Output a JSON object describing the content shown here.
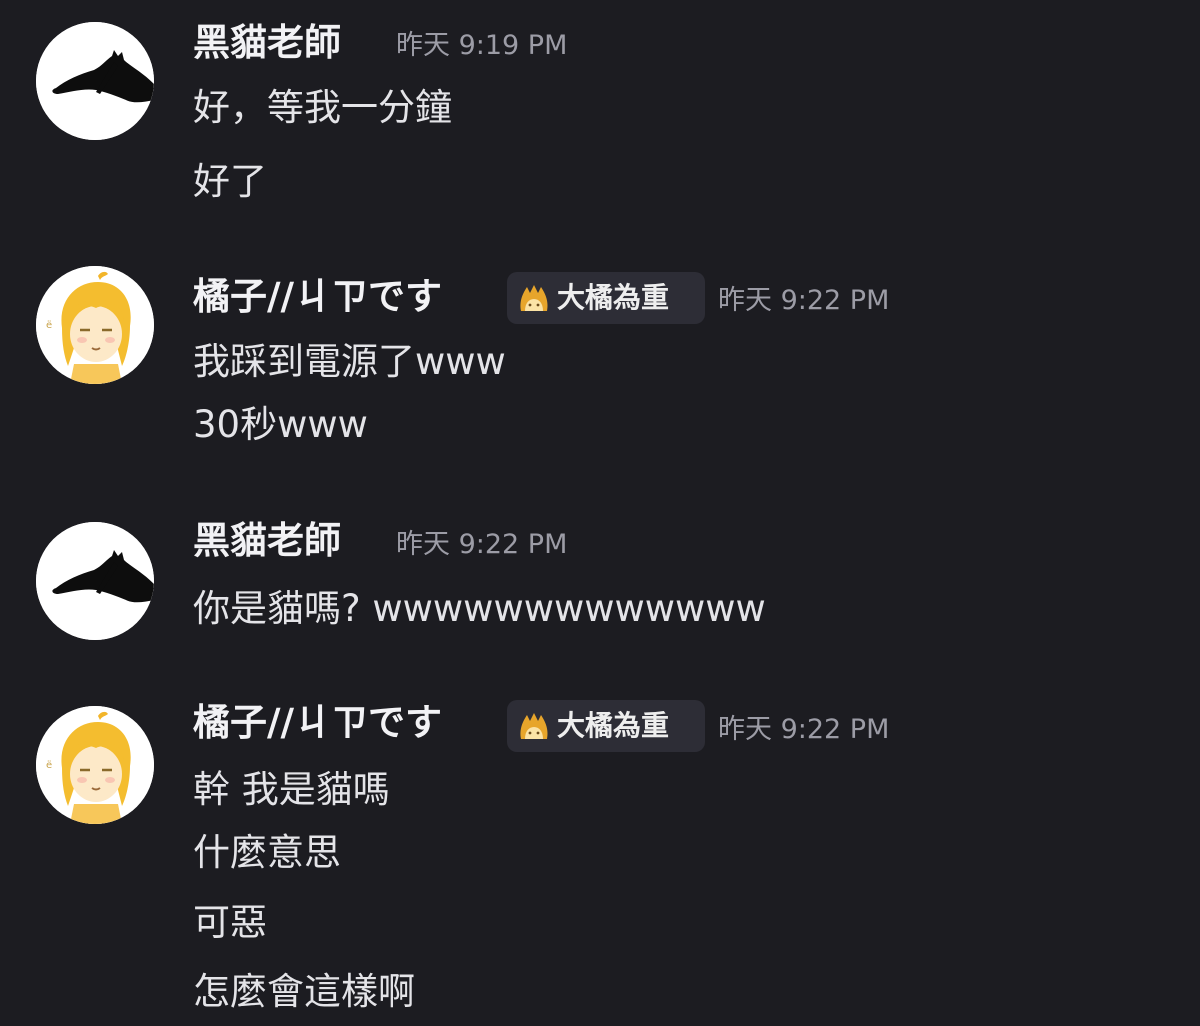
{
  "messages": [
    {
      "author": "黑貓老師",
      "avatar_icon": "black-cat-avatar",
      "timestamp": "昨天 9:19 PM",
      "lines": [
        "好，等我一分鐘",
        "好了"
      ]
    },
    {
      "author": "橘子//ㄐㄗです",
      "avatar_icon": "orange-hair-girl-avatar",
      "role_badge": {
        "icon": "flame-cat-icon",
        "label": "大橘為重"
      },
      "timestamp": "昨天 9:22 PM",
      "lines": [
        "我踩到電源了www",
        "30秒www"
      ]
    },
    {
      "author": "黑貓老師",
      "avatar_icon": "black-cat-avatar",
      "timestamp": "昨天 9:22 PM",
      "lines": [
        "你是貓嗎? wwwwwwwwwwwww"
      ]
    },
    {
      "author": "橘子//ㄐㄗです",
      "avatar_icon": "orange-hair-girl-avatar",
      "role_badge": {
        "icon": "flame-cat-icon",
        "label": "大橘為重"
      },
      "timestamp": "昨天 9:22 PM",
      "lines": [
        "幹 我是貓嗎",
        "什麼意思",
        "可惡",
        "怎麼會這樣啊"
      ]
    }
  ],
  "colors": {
    "background": "#1c1c21",
    "username": "#f2f2f5",
    "timestamp": "#9c9ca6",
    "role_tag_bg": "#2d2d36",
    "message_text": "#e4e4e8"
  }
}
